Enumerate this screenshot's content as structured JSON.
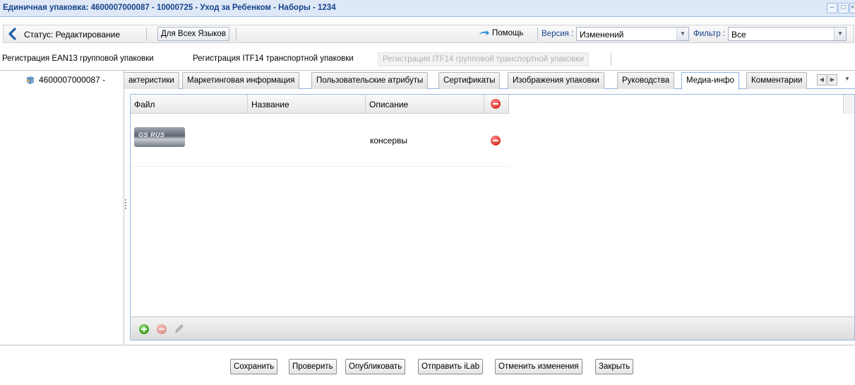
{
  "window": {
    "title": "Единичная упаковка: 4600007000087 - 10000725 - Уход за Ребенком - Наборы - 1234",
    "controls": [
      "minimize-icon",
      "maximize-icon",
      "close-icon"
    ]
  },
  "toolbar": {
    "status_label": "Статус: Редактирование",
    "all_languages_button": "Для Всех Языков",
    "help_label": "Помощь",
    "version_label": "Версия :",
    "version_value": "Изменений",
    "filter_label": "Фильтр :",
    "filter_value": "Все"
  },
  "registration": {
    "items": [
      {
        "label": "Регистрация EAN13 групповой упаковки",
        "enabled": true
      },
      {
        "label": "Регистрация ITF14 транспортной упаковки",
        "enabled": true
      },
      {
        "label": "Регистрация ITF14 групповой транспортной упаковки",
        "enabled": false
      }
    ]
  },
  "tree": {
    "node_label": "4600007000087 -"
  },
  "tabs": [
    {
      "label": "актеристики",
      "active": false
    },
    {
      "label": "Маркетинговая информация",
      "active": false
    },
    {
      "label": "Пользовательские атрибуты",
      "active": false
    },
    {
      "label": "Сертификаты",
      "active": false
    },
    {
      "label": "Изображения упаковки",
      "active": false
    },
    {
      "label": "Руководства",
      "active": false
    },
    {
      "label": "Медиа-инфо",
      "active": true
    },
    {
      "label": "Комментарии",
      "active": false
    }
  ],
  "grid": {
    "columns": [
      "Файл",
      "Название",
      "Описание"
    ],
    "rows": [
      {
        "file_thumbnail_text": "GS RUS",
        "name": "",
        "description": "консервы"
      }
    ]
  },
  "actions": {
    "save": "Сохранить",
    "check": "Проверить",
    "publish": "Опубликовать",
    "send_ilab": "Отправить iLab",
    "cancel_changes": "Отменить изменения",
    "close": "Закрыть"
  },
  "colors": {
    "title_text": "#15428b",
    "tab_border_active": "#8db2e3",
    "delete_red": "#d9342b",
    "add_green": "#3a9a1c"
  }
}
